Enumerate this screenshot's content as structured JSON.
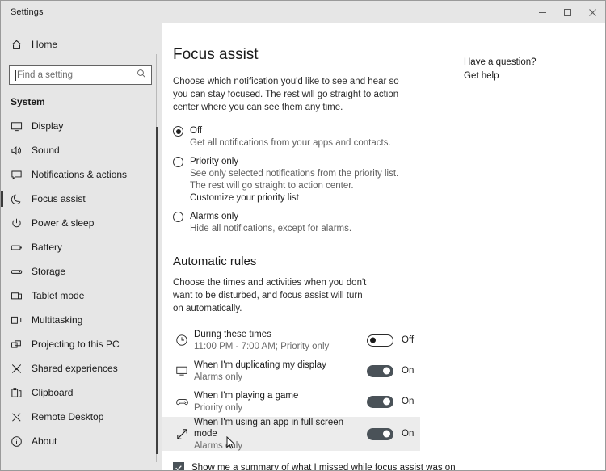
{
  "window": {
    "title": "Settings",
    "controls": [
      {
        "name": "minimize",
        "glyph": "minimize-icon"
      },
      {
        "name": "maximize",
        "glyph": "maximize-icon"
      },
      {
        "name": "close",
        "glyph": "close-icon"
      }
    ]
  },
  "sidebar": {
    "home_label": "Home",
    "home_icon": "home-icon",
    "search": {
      "placeholder": "Find a setting",
      "value": "",
      "icon": "search-icon"
    },
    "group_label": "System",
    "items": [
      {
        "label": "Display",
        "icon": "monitor-icon",
        "selected": false
      },
      {
        "label": "Sound",
        "icon": "speaker-icon",
        "selected": false
      },
      {
        "label": "Notifications & actions",
        "icon": "notification-icon",
        "selected": false
      },
      {
        "label": "Focus assist",
        "icon": "moon-icon",
        "selected": true
      },
      {
        "label": "Power & sleep",
        "icon": "power-icon",
        "selected": false
      },
      {
        "label": "Battery",
        "icon": "battery-icon",
        "selected": false
      },
      {
        "label": "Storage",
        "icon": "storage-icon",
        "selected": false
      },
      {
        "label": "Tablet mode",
        "icon": "tablet-icon",
        "selected": false
      },
      {
        "label": "Multitasking",
        "icon": "multitasking-icon",
        "selected": false
      },
      {
        "label": "Projecting to this PC",
        "icon": "projecting-icon",
        "selected": false
      },
      {
        "label": "Shared experiences",
        "icon": "share-icon",
        "selected": false
      },
      {
        "label": "Clipboard",
        "icon": "clipboard-icon",
        "selected": false
      },
      {
        "label": "Remote Desktop",
        "icon": "remote-desktop-icon",
        "selected": false
      },
      {
        "label": "About",
        "icon": "info-icon",
        "selected": false
      }
    ]
  },
  "main": {
    "title": "Focus assist",
    "description": "Choose which notification you'd like to see and hear so you can stay focused. The rest will go straight to action center where you can see them any time.",
    "radios": [
      {
        "label": "Off",
        "sub": "Get all notifications from your apps and contacts.",
        "selected": true,
        "link": ""
      },
      {
        "label": "Priority only",
        "sub": "See only selected notifications from the priority list. The rest will go straight to action center.",
        "selected": false,
        "link": "Customize your priority list"
      },
      {
        "label": "Alarms only",
        "sub": "Hide all notifications, except for alarms.",
        "selected": false,
        "link": ""
      }
    ],
    "automatic_rules": {
      "title": "Automatic rules",
      "description": "Choose the times and activities when you don't want to be disturbed, and focus assist will turn on automatically.",
      "rules": [
        {
          "title": "During these times",
          "subtitle": "11:00 PM - 7:00 AM; Priority only",
          "icon": "clock-icon",
          "toggle": "off",
          "state_label": "Off",
          "hovered": false
        },
        {
          "title": "When I'm duplicating my display",
          "subtitle": "Alarms only",
          "icon": "monitor-icon",
          "toggle": "on",
          "state_label": "On",
          "hovered": false
        },
        {
          "title": "When I'm playing a game",
          "subtitle": "Priority only",
          "icon": "gamepad-icon",
          "toggle": "on",
          "state_label": "On",
          "hovered": false
        },
        {
          "title": "When I'm using an app in full screen mode",
          "subtitle": "Alarms only",
          "icon": "fullscreen-icon",
          "toggle": "on",
          "state_label": "On",
          "hovered": true
        }
      ]
    },
    "summary_checkbox": {
      "label": "Show me a summary of what I missed while focus assist was on",
      "checked": true
    }
  },
  "help": {
    "title": "Have a question?",
    "link": "Get help"
  },
  "colors": {
    "sidebar_bg": "#e6e6e6",
    "toggle_on": "#4a5258",
    "accent_selection": "#3a3a3a",
    "text_primary": "#1a1a1a",
    "text_secondary": "#6a6a6a"
  }
}
